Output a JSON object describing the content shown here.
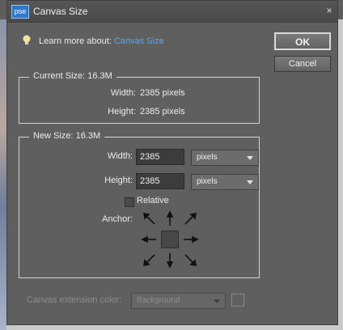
{
  "window": {
    "app_icon_text": "pse",
    "title": "Canvas Size",
    "close_glyph": "×"
  },
  "help": {
    "prefix": "Learn more about:",
    "link": "Canvas Size"
  },
  "buttons": {
    "ok": "OK",
    "cancel": "Cancel"
  },
  "current_size": {
    "legend": "Current Size: 16.3M",
    "width_label": "Width:",
    "width_value": "2385 pixels",
    "height_label": "Height:",
    "height_value": "2385 pixels"
  },
  "new_size": {
    "legend": "New Size: 16.3M",
    "width_label": "Width:",
    "width_value": "2385",
    "width_unit": "pixels",
    "height_label": "Height:",
    "height_value": "2385",
    "height_unit": "pixels",
    "relative_label": "Relative",
    "relative_checked": false,
    "anchor_label": "Anchor:"
  },
  "extension": {
    "label": "Canvas extension color:",
    "value": "Background"
  },
  "colors": {
    "dialog_bg": "#5f5f5f",
    "link": "#5aa7ee",
    "title_icon": "#2e77c9"
  }
}
